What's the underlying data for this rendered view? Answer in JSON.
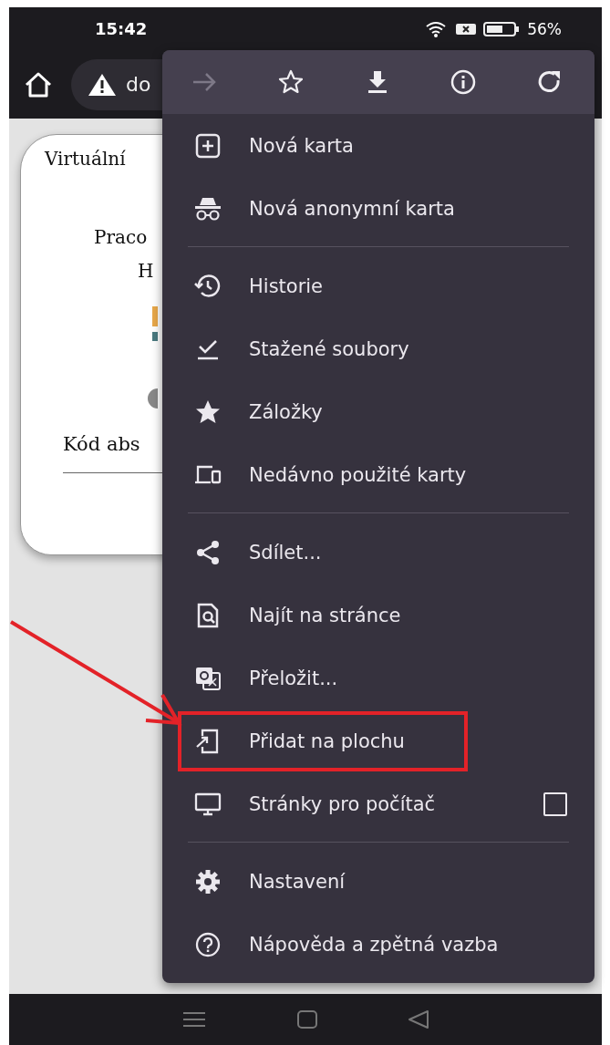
{
  "status_bar": {
    "time": "15:42",
    "battery": "56%"
  },
  "address_bar": {
    "url": "do"
  },
  "page": {
    "title": "Virtuální",
    "line_1": "Praco",
    "line_2": "H",
    "field_label": "Kód abs"
  },
  "menu": {
    "toolbar": [
      {
        "kind": "forward",
        "disabled": true
      },
      {
        "kind": "star",
        "disabled": false
      },
      {
        "kind": "download",
        "disabled": false
      },
      {
        "kind": "info",
        "disabled": false
      },
      {
        "kind": "reload",
        "disabled": false
      }
    ],
    "groups": [
      [
        {
          "kind": "new-tab",
          "label": "Nová karta",
          "highlighted": false
        },
        {
          "kind": "incognito",
          "label": "Nová anonymní karta",
          "highlighted": false
        }
      ],
      [
        {
          "kind": "history",
          "label": "Historie",
          "highlighted": false
        },
        {
          "kind": "downloads",
          "label": "Stažené soubory",
          "highlighted": false
        },
        {
          "kind": "bookmarks",
          "label": "Záložky",
          "highlighted": false
        },
        {
          "kind": "recent-tabs",
          "label": "Nedávno použité karty",
          "highlighted": false
        }
      ],
      [
        {
          "kind": "share",
          "label": "Sdílet...",
          "highlighted": false
        },
        {
          "kind": "find",
          "label": "Najít na stránce",
          "highlighted": false
        },
        {
          "kind": "translate",
          "label": "Přeložit...",
          "highlighted": false
        },
        {
          "kind": "add-home",
          "label": "Přidat na plochu",
          "highlighted": true
        },
        {
          "kind": "desktop",
          "label": "Stránky pro počítač",
          "highlighted": false,
          "checked": false
        }
      ],
      [
        {
          "kind": "settings",
          "label": "Nastavení",
          "highlighted": false
        },
        {
          "kind": "help",
          "label": "Nápověda a zpětná vazba",
          "highlighted": false
        }
      ]
    ]
  }
}
